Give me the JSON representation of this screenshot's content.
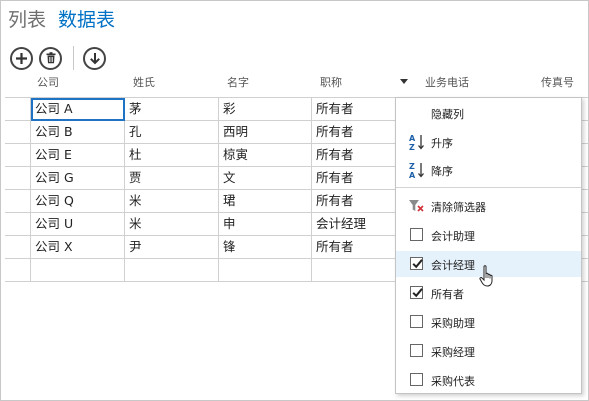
{
  "view_tabs": [
    {
      "label": "列表",
      "active": false
    },
    {
      "label": "数据表",
      "active": true
    }
  ],
  "toolbar": {
    "add_icon": "plus-circle-icon",
    "delete_icon": "trash-circle-icon",
    "download_icon": "down-arrow-circle-icon"
  },
  "columns": {
    "company": "公司",
    "surname": "姓氏",
    "given_name": "名字",
    "job_title": "职称",
    "business_phone": "业务电话",
    "fax": "传真号"
  },
  "rows": [
    {
      "company": "公司 A",
      "surname": "茅",
      "given_name": "彩",
      "job_title": "所有者"
    },
    {
      "company": "公司 B",
      "surname": "孔",
      "given_name": "西明",
      "job_title": "所有者"
    },
    {
      "company": "公司 E",
      "surname": "杜",
      "given_name": "椋寅",
      "job_title": "所有者"
    },
    {
      "company": "公司 G",
      "surname": "贾",
      "given_name": "文",
      "job_title": "所有者"
    },
    {
      "company": "公司 Q",
      "surname": "米",
      "given_name": "珺",
      "job_title": "所有者"
    },
    {
      "company": "公司 U",
      "surname": "米",
      "given_name": "申",
      "job_title": "会计经理"
    },
    {
      "company": "公司 X",
      "surname": "尹",
      "given_name": "锋",
      "job_title": "所有者"
    },
    {
      "company": "",
      "surname": "",
      "given_name": "",
      "job_title": ""
    }
  ],
  "dropdown": {
    "hide_column": "隐藏列",
    "sort_asc": "升序",
    "sort_desc": "降序",
    "clear_filter": "清除筛选器",
    "sort_asc_icon_text": "A Z",
    "sort_desc_icon_text": "Z A",
    "filters": [
      {
        "label": "会计助理",
        "checked": false,
        "hover": false
      },
      {
        "label": "会计经理",
        "checked": true,
        "hover": true
      },
      {
        "label": "所有者",
        "checked": true,
        "hover": false
      },
      {
        "label": "采购助理",
        "checked": false,
        "hover": false
      },
      {
        "label": "采购经理",
        "checked": false,
        "hover": false
      },
      {
        "label": "采购代表",
        "checked": false,
        "hover": false
      }
    ]
  },
  "colors": {
    "accent": "#0072c6",
    "selection_border": "#1e73c4",
    "hover_bg": "#e5f1fb",
    "clear_filter_red": "#d13438"
  }
}
